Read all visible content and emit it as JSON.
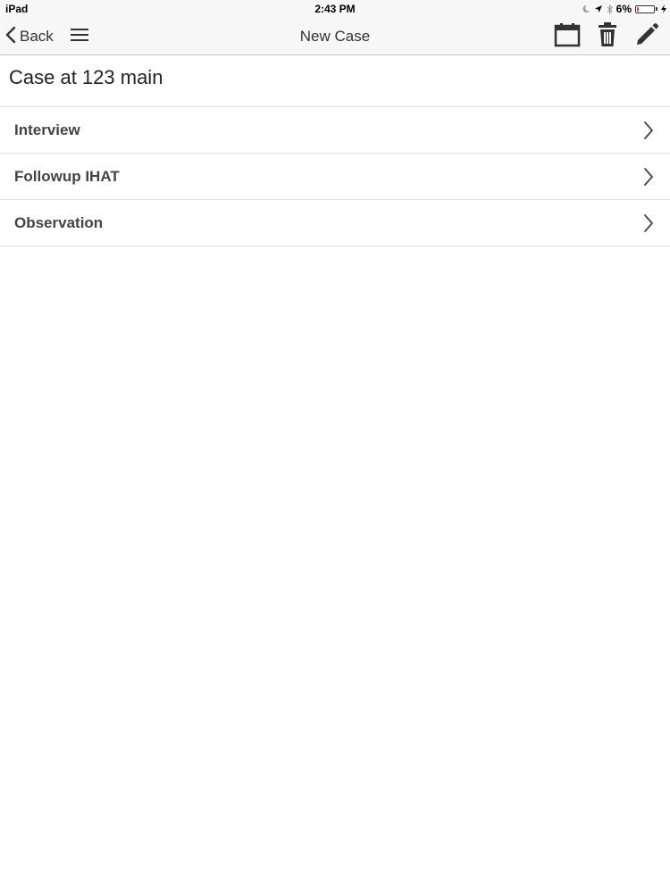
{
  "status_bar": {
    "device": "iPad",
    "time": "2:43 PM",
    "battery_percent": "6%",
    "battery_level": 0.06,
    "battery_color": "#e23b3b",
    "icons": [
      "moon-icon",
      "location-arrow-icon",
      "bluetooth-icon",
      "battery-icon",
      "charging-bolt-icon"
    ]
  },
  "nav_bar": {
    "back_label": "Back",
    "title": "New Case",
    "icons": [
      "chevron-left-icon",
      "hamburger-menu-icon",
      "calendar-icon",
      "trash-icon",
      "pencil-icon"
    ]
  },
  "case": {
    "title": "Case at 123 main"
  },
  "list": {
    "items": [
      {
        "label": "Interview"
      },
      {
        "label": "Followup IHAT"
      },
      {
        "label": "Observation"
      }
    ]
  }
}
